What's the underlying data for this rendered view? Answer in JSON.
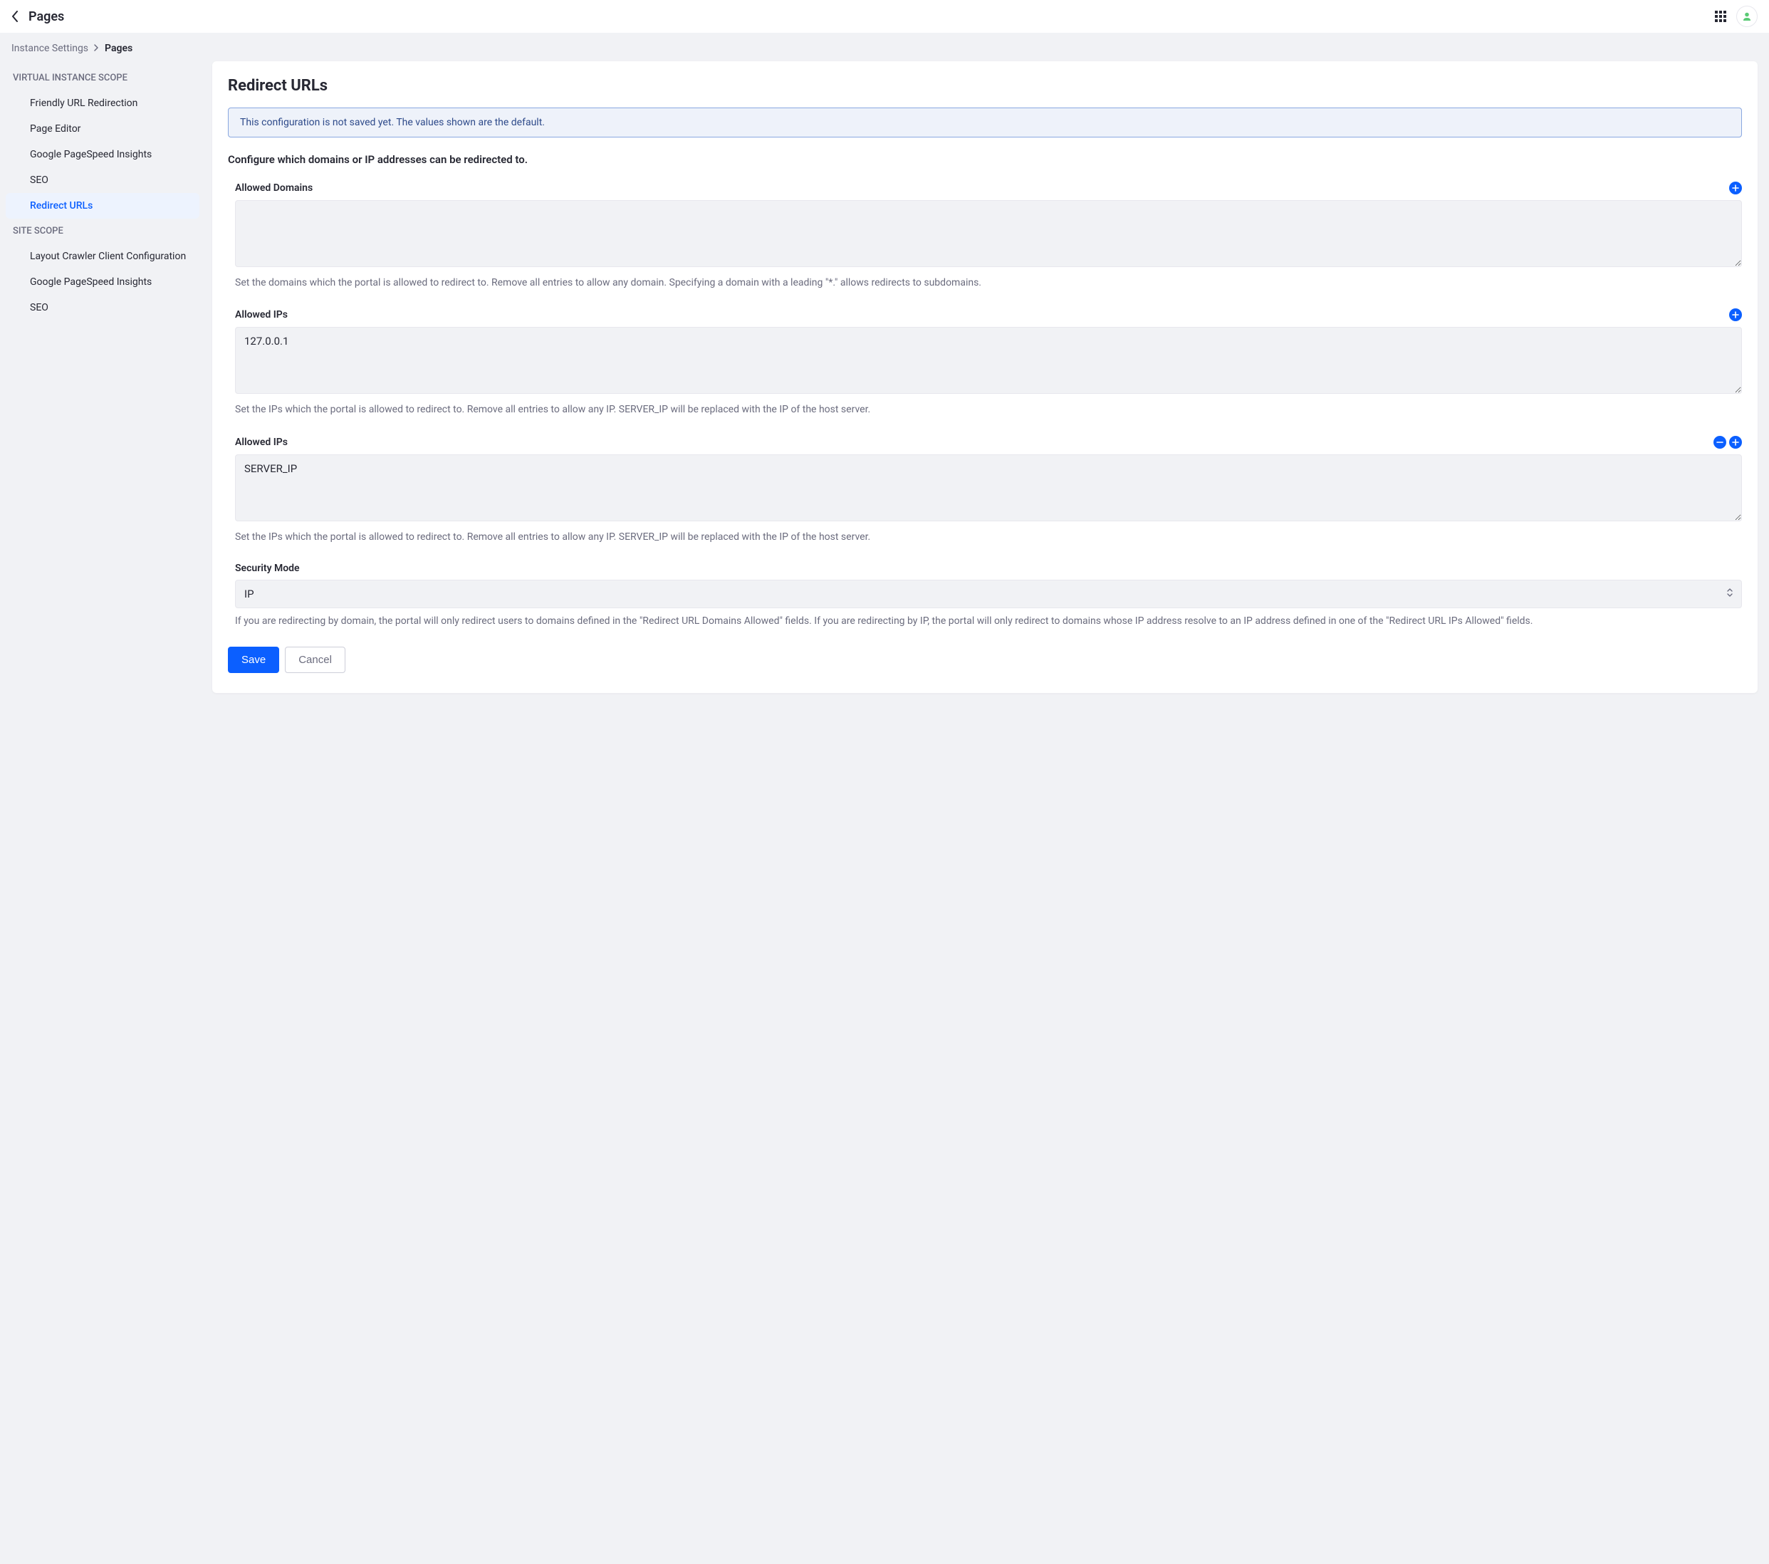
{
  "header": {
    "title": "Pages"
  },
  "breadcrumb": {
    "root": "Instance Settings",
    "current": "Pages"
  },
  "sidebar": {
    "sections": [
      {
        "heading": "VIRTUAL INSTANCE SCOPE",
        "items": [
          {
            "label": "Friendly URL Redirection",
            "active": false
          },
          {
            "label": "Page Editor",
            "active": false
          },
          {
            "label": "Google PageSpeed Insights",
            "active": false
          },
          {
            "label": "SEO",
            "active": false
          },
          {
            "label": "Redirect URLs",
            "active": true
          }
        ]
      },
      {
        "heading": "SITE SCOPE",
        "items": [
          {
            "label": "Layout Crawler Client Configuration",
            "active": false
          },
          {
            "label": "Google PageSpeed Insights",
            "active": false
          },
          {
            "label": "SEO",
            "active": false
          }
        ]
      }
    ]
  },
  "panel": {
    "title": "Redirect URLs",
    "info_banner": "This configuration is not saved yet. The values shown are the default.",
    "subheading": "Configure which domains or IP addresses can be redirected to.",
    "fields": [
      {
        "label": "Allowed Domains",
        "value": "",
        "help": "Set the domains which the portal is allowed to redirect to. Remove all entries to allow any domain. Specifying a domain with a leading \"*.\" allows redirects to subdomains.",
        "show_add": true,
        "show_remove": false
      },
      {
        "label": "Allowed IPs",
        "value": "127.0.0.1",
        "help": "Set the IPs which the portal is allowed to redirect to. Remove all entries to allow any IP. SERVER_IP will be replaced with the IP of the host server.",
        "show_add": true,
        "show_remove": false
      },
      {
        "label": "Allowed IPs",
        "value": "SERVER_IP",
        "help": "Set the IPs which the portal is allowed to redirect to. Remove all entries to allow any IP. SERVER_IP will be replaced with the IP of the host server.",
        "show_add": true,
        "show_remove": true
      }
    ],
    "security_mode": {
      "label": "Security Mode",
      "value": "IP",
      "help": "If you are redirecting by domain, the portal will only redirect users to domains defined in the \"Redirect URL Domains Allowed\" fields. If you are redirecting by IP, the portal will only redirect to domains whose IP address resolve to an IP address defined in one of the \"Redirect URL IPs Allowed\" fields."
    },
    "actions": {
      "save_label": "Save",
      "cancel_label": "Cancel"
    }
  }
}
